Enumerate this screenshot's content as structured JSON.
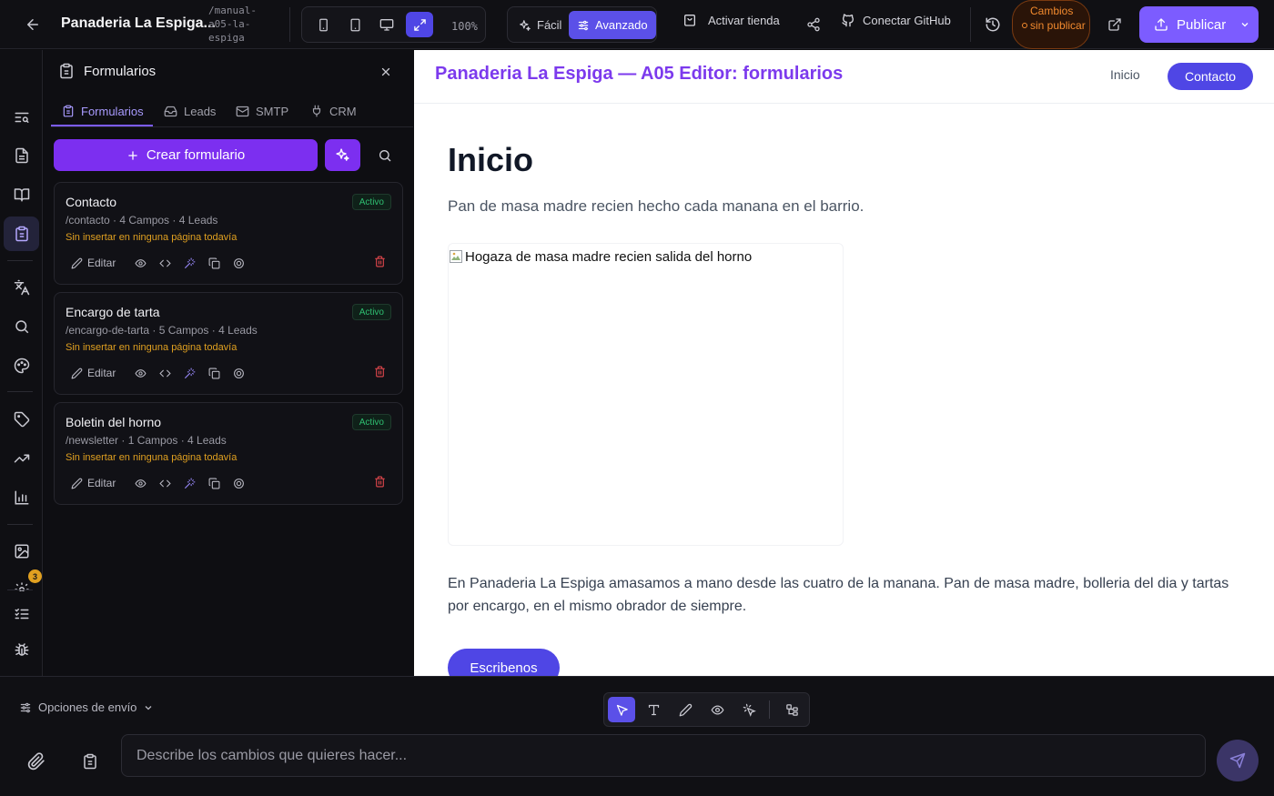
{
  "topbar": {
    "project_title": "Panaderia La Espiga...",
    "project_slug": "/manual-a05-la-espiga",
    "zoom": "100%",
    "mode_easy": "Fácil",
    "mode_advanced": "Avanzado",
    "activate_store": "Activar tienda",
    "connect_github": "Conectar GitHub",
    "unsaved_changes": "Cambios sin publicar",
    "publish": "Publicar"
  },
  "rail": {
    "badge_count": "3"
  },
  "panel": {
    "title": "Formularios",
    "tabs": [
      {
        "label": "Formularios"
      },
      {
        "label": "Leads"
      },
      {
        "label": "SMTP"
      },
      {
        "label": "CRM"
      }
    ],
    "create_button": "Crear formulario",
    "forms": [
      {
        "name": "Contacto",
        "meta": "/contacto · 4 Campos · 4 Leads",
        "warning": "Sin insertar en ninguna página todavía",
        "status": "Activo",
        "edit": "Editar"
      },
      {
        "name": "Encargo de tarta",
        "meta": "/encargo-de-tarta · 5 Campos · 4 Leads",
        "warning": "Sin insertar en ninguna página todavía",
        "status": "Activo",
        "edit": "Editar"
      },
      {
        "name": "Boletin del horno",
        "meta": "/newsletter · 1 Campos · 4 Leads",
        "warning": "Sin insertar en ninguna página todavía",
        "status": "Activo",
        "edit": "Editar"
      }
    ]
  },
  "preview": {
    "brand": "Panaderia La Espiga — A05 Editor: formularios",
    "nav_link": "Inicio",
    "nav_cta": "Contacto",
    "heading": "Inicio",
    "lead": "Pan de masa madre recien hecho cada manana en el barrio.",
    "image_alt": "Hogaza de masa madre recien salida del horno",
    "body": "En Panaderia La Espiga amasamos a mano desde las cuatro de la manana. Pan de masa madre, bolleria del dia y tartas por encargo, en el mismo obrador de siempre.",
    "button": "Escribenos"
  },
  "bottom": {
    "send_options": "Opciones de envío",
    "prompt_placeholder": "Describe los cambios que quieres hacer..."
  },
  "colors": {
    "accent": "#7c5cff",
    "create": "#7c2ff0",
    "brand_text": "#7c3aed",
    "site_button": "#4f46e5",
    "status_green": "#2fbf71",
    "warning": "#e0a020",
    "delete": "#e5484d"
  }
}
